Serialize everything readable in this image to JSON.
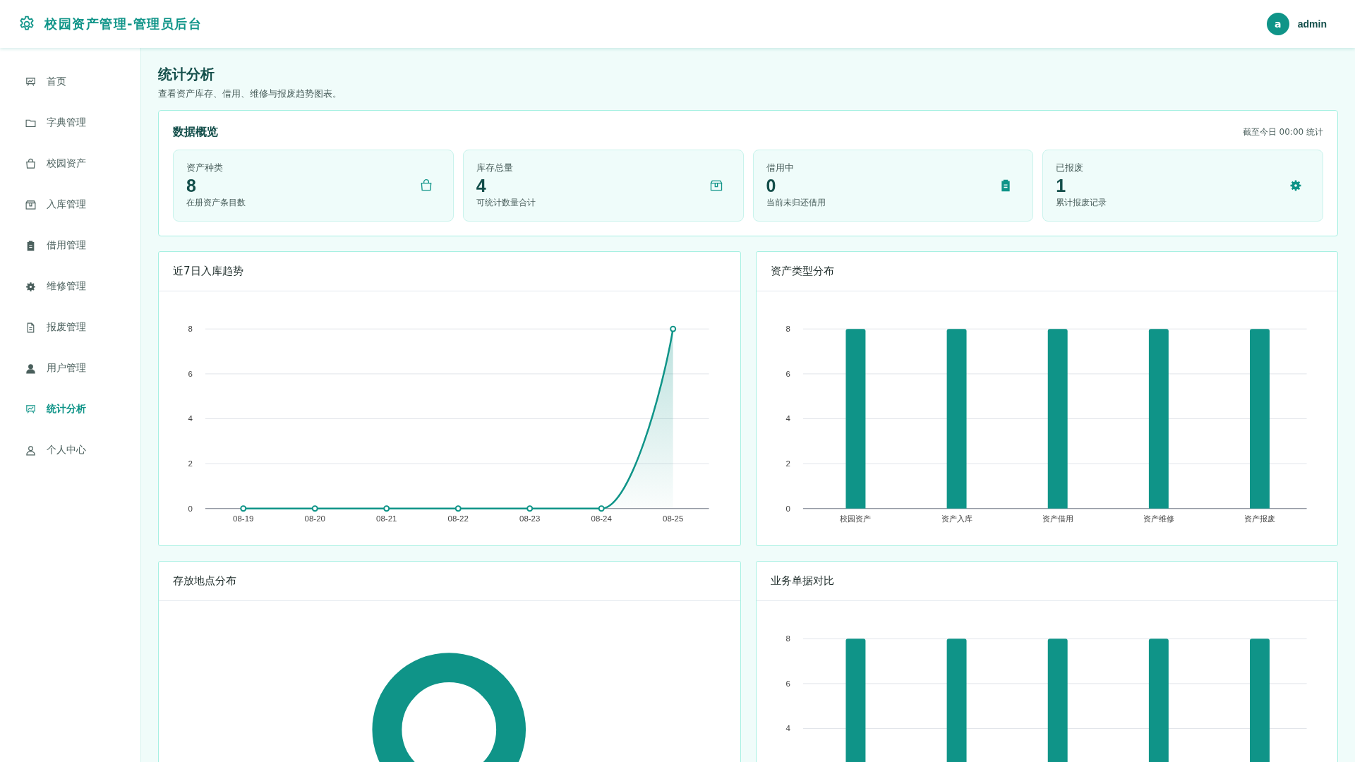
{
  "header": {
    "title": "校园资产管理-管理员后台",
    "user": {
      "avatar_letter": "a",
      "name": "admin"
    }
  },
  "sidebar": {
    "items": [
      {
        "label": "首页",
        "selected": false
      },
      {
        "label": "字典管理",
        "selected": false
      },
      {
        "label": "校园资产",
        "selected": false
      },
      {
        "label": "入库管理",
        "selected": false
      },
      {
        "label": "借用管理",
        "selected": false
      },
      {
        "label": "维修管理",
        "selected": false
      },
      {
        "label": "报废管理",
        "selected": false
      },
      {
        "label": "用户管理",
        "selected": false
      },
      {
        "label": "统计分析",
        "selected": true
      },
      {
        "label": "个人中心",
        "selected": false
      }
    ]
  },
  "page": {
    "title": "统计分析",
    "subtitle": "查看资产库存、借用、维修与报废趋势图表。"
  },
  "overview": {
    "title": "数据概览",
    "note": "截至今日 00:00 统计",
    "stats": [
      {
        "label": "资产种类",
        "value": "8",
        "caption": "在册资产条目数"
      },
      {
        "label": "库存总量",
        "value": "4",
        "caption": "可统计数量合计"
      },
      {
        "label": "借用中",
        "value": "0",
        "caption": "当前未归还借用"
      },
      {
        "label": "已报废",
        "value": "1",
        "caption": "累计报废记录"
      }
    ]
  },
  "panels": [
    {
      "title": "近7日入库趋势",
      "chart_data": {
        "type": "line",
        "categories": [
          "08-19",
          "08-20",
          "08-21",
          "08-22",
          "08-23",
          "08-24",
          "08-25"
        ],
        "values": [
          0,
          0,
          0,
          0,
          0,
          0,
          8
        ],
        "ylim": [
          0,
          8
        ],
        "yticks": [
          0,
          2,
          4,
          6,
          8
        ],
        "grid": true,
        "marker": true
      }
    },
    {
      "title": "资产类型分布",
      "chart_data": {
        "type": "bar",
        "categories": [
          "校园资产",
          "资产入库",
          "资产借用",
          "资产维修",
          "资产报废"
        ],
        "values": [
          8,
          8,
          8,
          8,
          8
        ],
        "ylim": [
          0,
          8
        ],
        "yticks": [
          0,
          2,
          4,
          6,
          8
        ],
        "grid": true
      }
    },
    {
      "title": "存放地点分布",
      "kind": "donut"
    },
    {
      "title": "业务单据对比",
      "chart_data": {
        "type": "bar",
        "values": [
          8,
          8,
          8,
          8,
          8
        ],
        "ylim": [
          0,
          8
        ],
        "yticks": [
          4,
          6,
          8
        ],
        "grid": true
      }
    }
  ]
}
